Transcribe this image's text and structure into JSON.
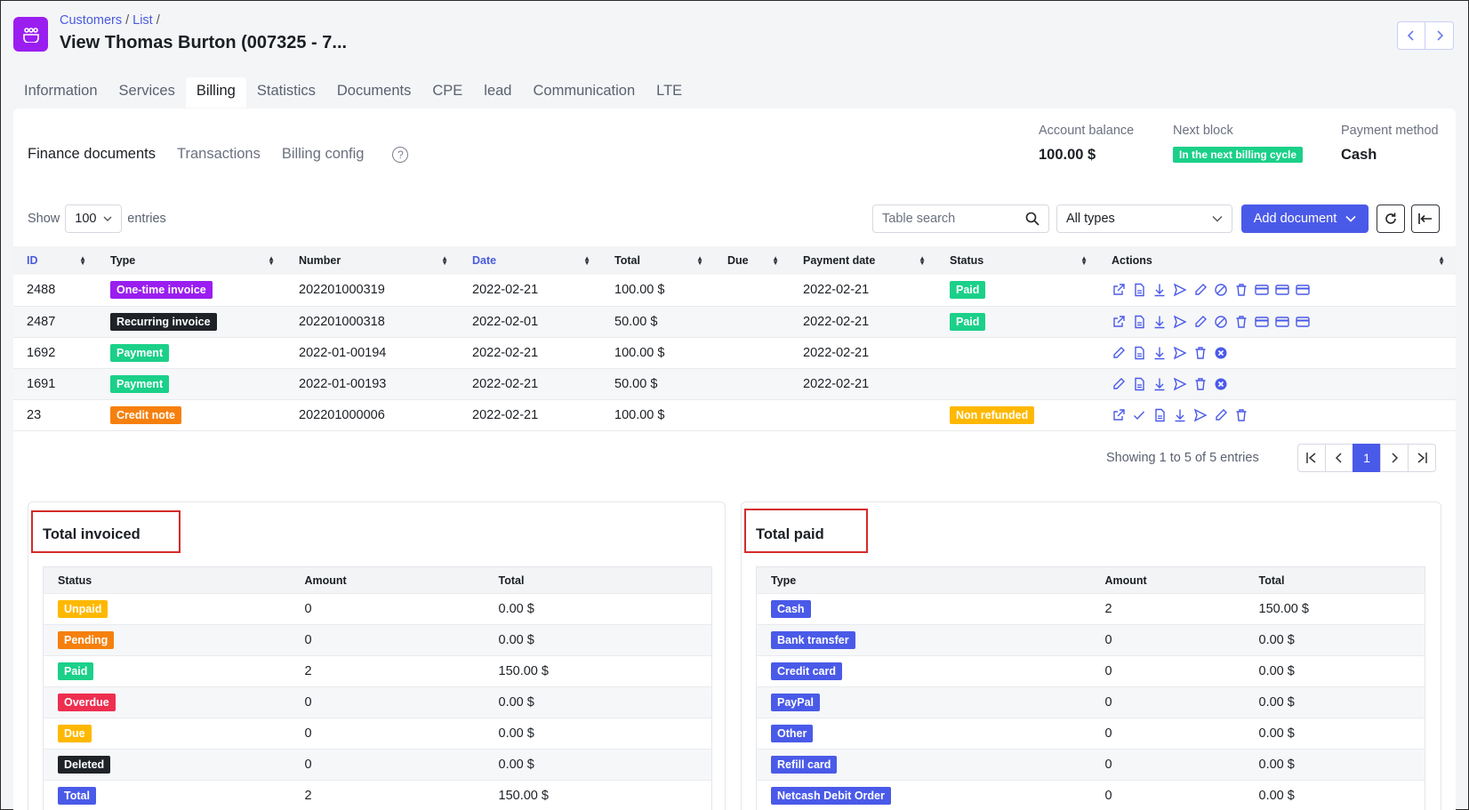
{
  "header": {
    "breadcrumb": [
      "Customers",
      "List"
    ],
    "title": "View Thomas Burton (007325 - 7..."
  },
  "tabs": [
    "Information",
    "Services",
    "Billing",
    "Statistics",
    "Documents",
    "CPE",
    "lead",
    "Communication",
    "LTE"
  ],
  "active_tab": "Billing",
  "subtabs": [
    "Finance documents",
    "Transactions",
    "Billing config"
  ],
  "help_label": "?",
  "account": {
    "balance_label": "Account balance",
    "balance_value": "100.00 $",
    "next_block_label": "Next block",
    "next_block_value": "In the next billing cycle",
    "payment_method_label": "Payment method",
    "payment_method_value": "Cash"
  },
  "toolbar": {
    "show_label": "Show",
    "entries_value": "100",
    "entries_label": "entries",
    "search_placeholder": "Table search",
    "types_value": "All types",
    "add_label": "Add document"
  },
  "table": {
    "columns": [
      "ID",
      "Type",
      "Number",
      "Date",
      "Total",
      "Due",
      "Payment date",
      "Status",
      "Actions"
    ],
    "rows": [
      {
        "id": "2488",
        "type": "One-time invoice",
        "type_color": "#9a1ef0",
        "number": "202201000319",
        "date": "2022-02-21",
        "total": "100.00 $",
        "due": "",
        "payment_date": "2022-02-21",
        "status": "Paid",
        "status_color": "#1bd089"
      },
      {
        "id": "2487",
        "type": "Recurring invoice",
        "type_color": "#1f2328",
        "number": "202201000318",
        "date": "2022-02-01",
        "total": "50.00 $",
        "due": "",
        "payment_date": "2022-02-21",
        "status": "Paid",
        "status_color": "#1bd089"
      },
      {
        "id": "1692",
        "type": "Payment",
        "type_color": "#1bd089",
        "number": "2022-01-00194",
        "date": "2022-02-21",
        "total": "100.00 $",
        "due": "",
        "payment_date": "2022-02-21",
        "status": "",
        "status_color": ""
      },
      {
        "id": "1691",
        "type": "Payment",
        "type_color": "#1bd089",
        "number": "2022-01-00193",
        "date": "2022-02-21",
        "total": "50.00 $",
        "due": "",
        "payment_date": "2022-02-21",
        "status": "",
        "status_color": ""
      },
      {
        "id": "23",
        "type": "Credit note",
        "type_color": "#f6800e",
        "number": "202201000006",
        "date": "2022-02-21",
        "total": "100.00 $",
        "due": "",
        "payment_date": "",
        "status": "Non refunded",
        "status_color": "#ffb800"
      }
    ]
  },
  "pagination": {
    "summary": "Showing 1 to 5 of 5 entries",
    "current": "1"
  },
  "total_invoiced": {
    "title": "Total invoiced",
    "columns": [
      "Status",
      "Amount",
      "Total"
    ],
    "rows": [
      {
        "label": "Unpaid",
        "color": "#ffb800",
        "amount": "0",
        "total": "0.00 $"
      },
      {
        "label": "Pending",
        "color": "#f6800e",
        "amount": "0",
        "total": "0.00 $"
      },
      {
        "label": "Paid",
        "color": "#1bd089",
        "amount": "2",
        "total": "150.00 $"
      },
      {
        "label": "Overdue",
        "color": "#ee2e4f",
        "amount": "0",
        "total": "0.00 $"
      },
      {
        "label": "Due",
        "color": "#ffb800",
        "amount": "0",
        "total": "0.00 $"
      },
      {
        "label": "Deleted",
        "color": "#1f2328",
        "amount": "0",
        "total": "0.00 $"
      },
      {
        "label": "Total",
        "color": "#4a5ae8",
        "amount": "2",
        "total": "150.00 $"
      }
    ]
  },
  "total_paid": {
    "title": "Total paid",
    "columns": [
      "Type",
      "Amount",
      "Total"
    ],
    "rows": [
      {
        "label": "Cash",
        "color": "#4a5ae8",
        "amount": "2",
        "total": "150.00 $"
      },
      {
        "label": "Bank transfer",
        "color": "#4a5ae8",
        "amount": "0",
        "total": "0.00 $"
      },
      {
        "label": "Credit card",
        "color": "#4a5ae8",
        "amount": "0",
        "total": "0.00 $"
      },
      {
        "label": "PayPal",
        "color": "#4a5ae8",
        "amount": "0",
        "total": "0.00 $"
      },
      {
        "label": "Other",
        "color": "#4a5ae8",
        "amount": "0",
        "total": "0.00 $"
      },
      {
        "label": "Refill card",
        "color": "#4a5ae8",
        "amount": "0",
        "total": "0.00 $"
      },
      {
        "label": "Netcash Debit Order",
        "color": "#4a5ae8",
        "amount": "0",
        "total": "0.00 $"
      }
    ]
  }
}
